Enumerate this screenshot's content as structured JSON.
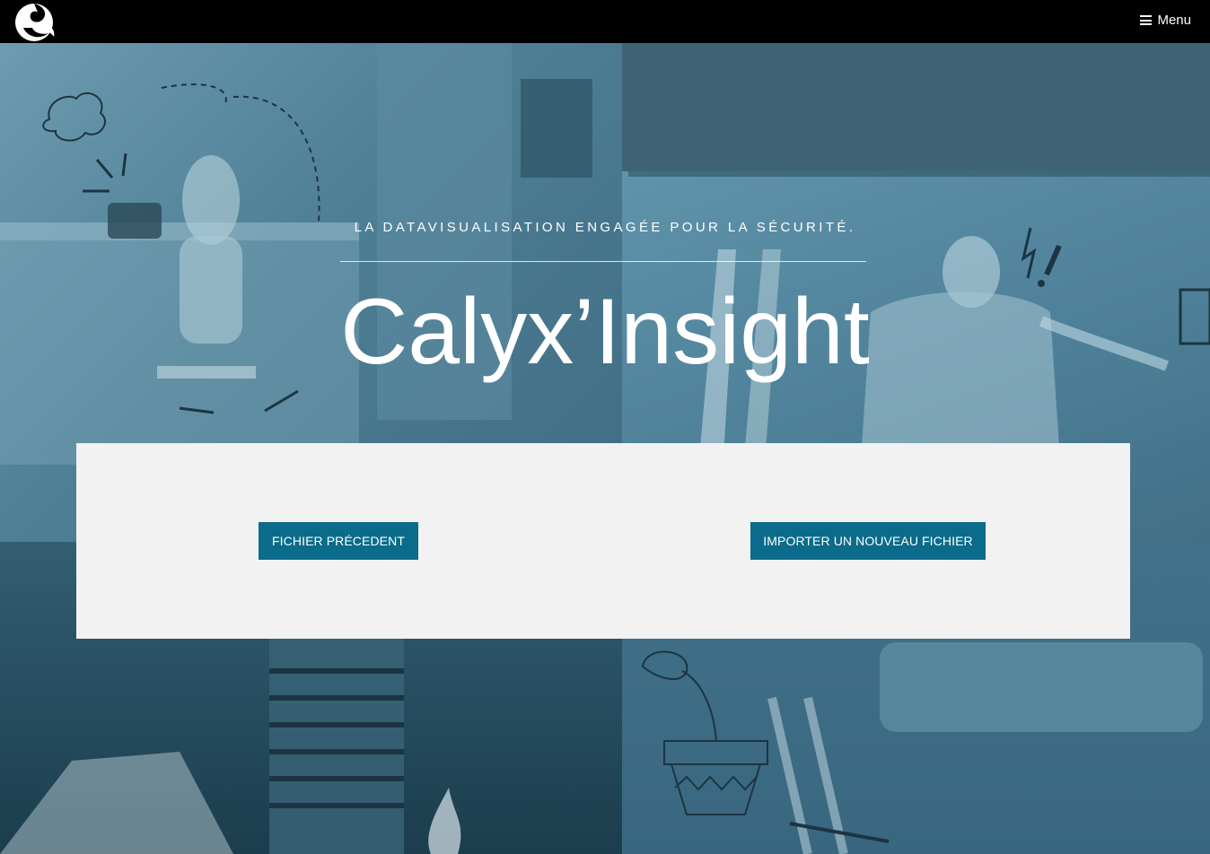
{
  "header": {
    "logo_icon": "calyx-logo-icon",
    "menu_label": "Menu",
    "menu_icon": "hamburger-icon"
  },
  "hero": {
    "tagline": "LA DATAVISUALISATION ENGAGÉE POUR LA SÉCURITÉ.",
    "title": "Calyx’Insight"
  },
  "actions": {
    "previous_file_label": "FICHIER PRÉCEDENT",
    "import_new_file_label": "IMPORTER UN NOUVEAU FICHIER"
  },
  "colors": {
    "topbar": "#000000",
    "button": "#0b6b8a",
    "panel": "#f2f2f2",
    "hero_tint": "#3b6a80"
  }
}
